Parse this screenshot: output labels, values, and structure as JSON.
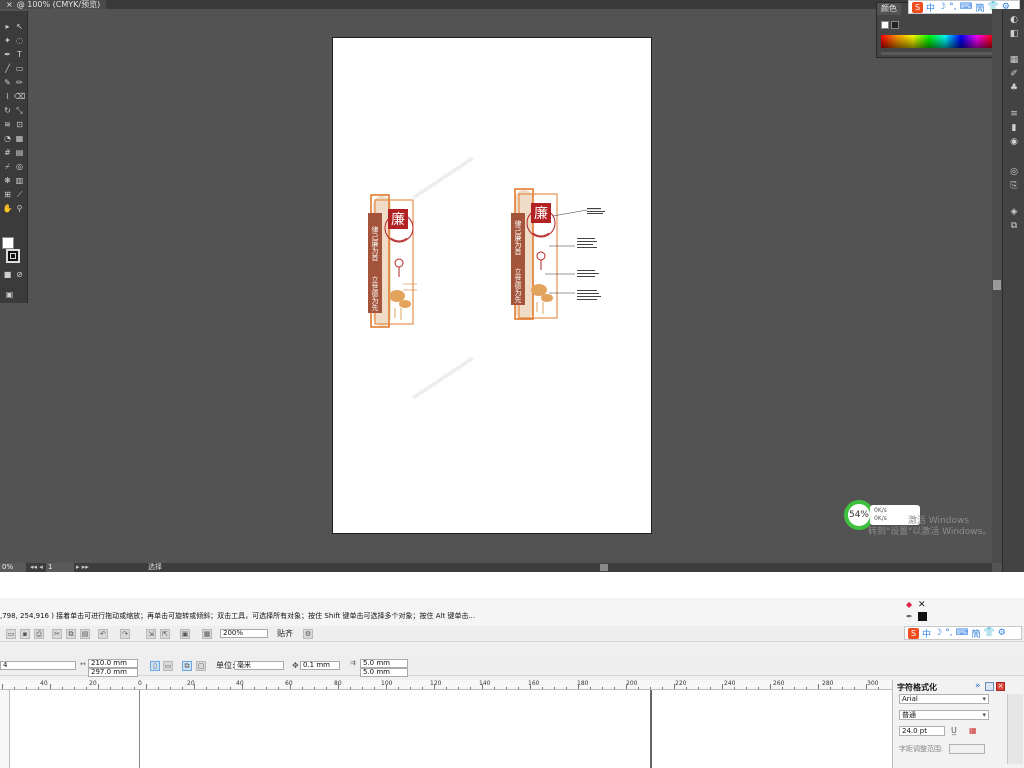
{
  "illustrator": {
    "tab_title": "@ 100% (CMYK/预览)",
    "tab_close": "×",
    "status": {
      "zoom": "0%",
      "page": "1",
      "mode": "选择"
    },
    "color_panel": {
      "tab": "颜色",
      "menu": "≡"
    },
    "ime": {
      "logo": "S",
      "lang": "中",
      "items": [
        "中",
        "☽",
        "°,",
        "⌨",
        "簡",
        "👕",
        "⚙"
      ]
    },
    "perf": {
      "percent": "54%",
      "line1": "0K/s",
      "line2": "0K/s"
    },
    "os_watermark": {
      "line1": "激活 Windows",
      "line2": "转到\"设置\"以激活 Windows。"
    }
  },
  "artwork": {
    "seal_char": "廉",
    "left_motto_1": "律己廉为首",
    "left_motto_2": "立世德为先",
    "right_motto_1": "律己廉为首",
    "right_motto_2": "立世德为先"
  },
  "corel": {
    "status_msg": ",798, 254,916 )      接着单击可进行拖动或缩放；再单击可旋转或倾斜；双击工具，可选择所有对象；按住 Shift 键单击可选择多个对象；按住 Alt 键单击...",
    "toolbar1": {
      "zoom": "200%",
      "snap": "贴齐",
      "ime_items": [
        "中",
        "☽",
        "°,",
        "⌨",
        "簡",
        "👕",
        "⚙"
      ]
    },
    "toolbar2": {
      "paper": "4",
      "width": "210.0 mm",
      "height": "297.0 mm",
      "units_label": "单位:",
      "units": "毫米",
      "nudge": "0.1 mm",
      "dup_x": "5.0 mm",
      "dup_y": "5.0 mm"
    },
    "ruler_labels": [
      "40",
      "20",
      "0",
      "20",
      "40",
      "60",
      "80",
      "100",
      "120",
      "140",
      "160",
      "180",
      "200",
      "220",
      "240",
      "260",
      "280",
      "300"
    ],
    "char_panel": {
      "title": "字符格式化",
      "font": "Arial",
      "style": "普通",
      "size": "24.0 pt",
      "range_label": "字距调整范围:",
      "expand": "»"
    }
  }
}
